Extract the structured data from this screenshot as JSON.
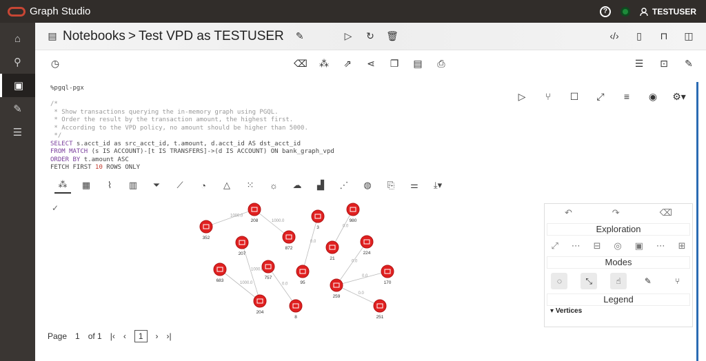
{
  "app": {
    "title": "Graph Studio"
  },
  "user": {
    "name": "TESTUSER"
  },
  "header": {
    "section": "Notebooks",
    "separator": ">",
    "notebook": "Test VPD as TESTUSER"
  },
  "code": {
    "lang": "%pgql-pgx",
    "comment_open": "/*",
    "c1": " * Show transactions querying the in-memory graph using PGQL.",
    "c2": " * Order the result by the transaction amount, the highest first.",
    "c3": " * According to the VPD policy, no amount should be higher than 5000.",
    "comment_close": " */",
    "kw_select": "SELECT",
    "select_rest": " s.acct_id as src_acct_id, t.amount, d.acct_id AS dst_acct_id",
    "kw_from": "FROM MATCH",
    "from_rest": " (s IS ACCOUNT)-[t IS TRANSFERS]->(d IS ACCOUNT) ON bank_graph_vpd",
    "kw_order": "ORDER BY",
    "order_rest": " t.amount ASC",
    "fetch_a": "FETCH FIRST ",
    "fetch_num": "10",
    "fetch_b": " ROWS ONLY"
  },
  "graph": {
    "nodes": [
      {
        "id": "352"
      },
      {
        "id": "208"
      },
      {
        "id": "872"
      },
      {
        "id": "207"
      },
      {
        "id": "683"
      },
      {
        "id": "757"
      },
      {
        "id": "204"
      },
      {
        "id": "8"
      },
      {
        "id": "3"
      },
      {
        "id": "95"
      },
      {
        "id": "980"
      },
      {
        "id": "21"
      },
      {
        "id": "224"
      },
      {
        "id": "259"
      },
      {
        "id": "170"
      },
      {
        "id": "251"
      }
    ],
    "edge_labels": [
      "1000.0",
      "1000.0",
      "1000.0",
      "1000.0",
      "0.0",
      "0.0",
      "0.0",
      "0.0",
      "0.0",
      "0.0"
    ]
  },
  "panel": {
    "exploration": "Exploration",
    "modes": "Modes",
    "legend": "Legend",
    "vertices": "Vertices"
  },
  "pager": {
    "page_label": "Page",
    "page": "1",
    "of": "of 1",
    "current": "1"
  }
}
